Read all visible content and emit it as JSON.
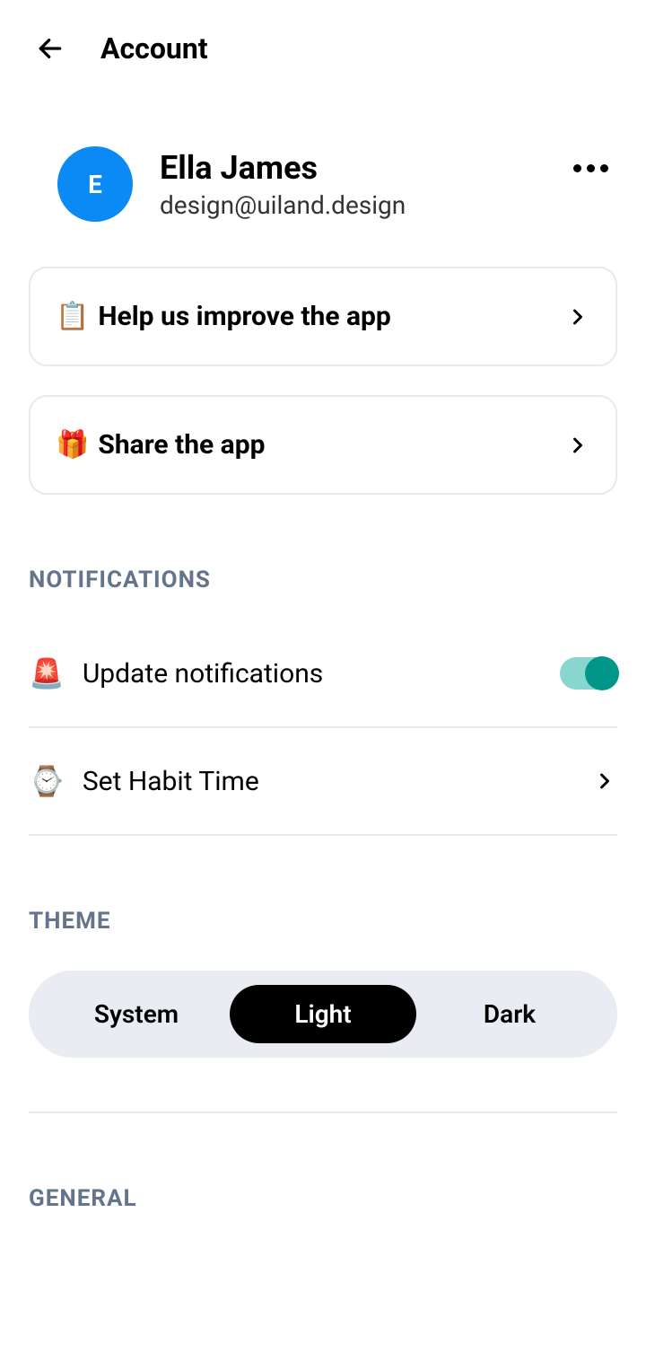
{
  "header": {
    "title": "Account"
  },
  "profile": {
    "avatar_initial": "E",
    "name": "Ella James",
    "email": "design@uiland.design"
  },
  "cards": {
    "help": {
      "emoji": "📋",
      "label": "Help us improve the app"
    },
    "share": {
      "emoji": "🎁",
      "label": "Share the app"
    }
  },
  "sections": {
    "notifications": {
      "title": "NOTIFICATIONS",
      "update": {
        "emoji": "🚨",
        "label": "Update notifications"
      },
      "habit": {
        "emoji": "⌚️",
        "label": "Set Habit Time"
      }
    },
    "theme": {
      "title": "THEME",
      "options": {
        "system": "System",
        "light": "Light",
        "dark": "Dark"
      },
      "selected": "light"
    },
    "general": {
      "title": "GENERAL"
    }
  }
}
